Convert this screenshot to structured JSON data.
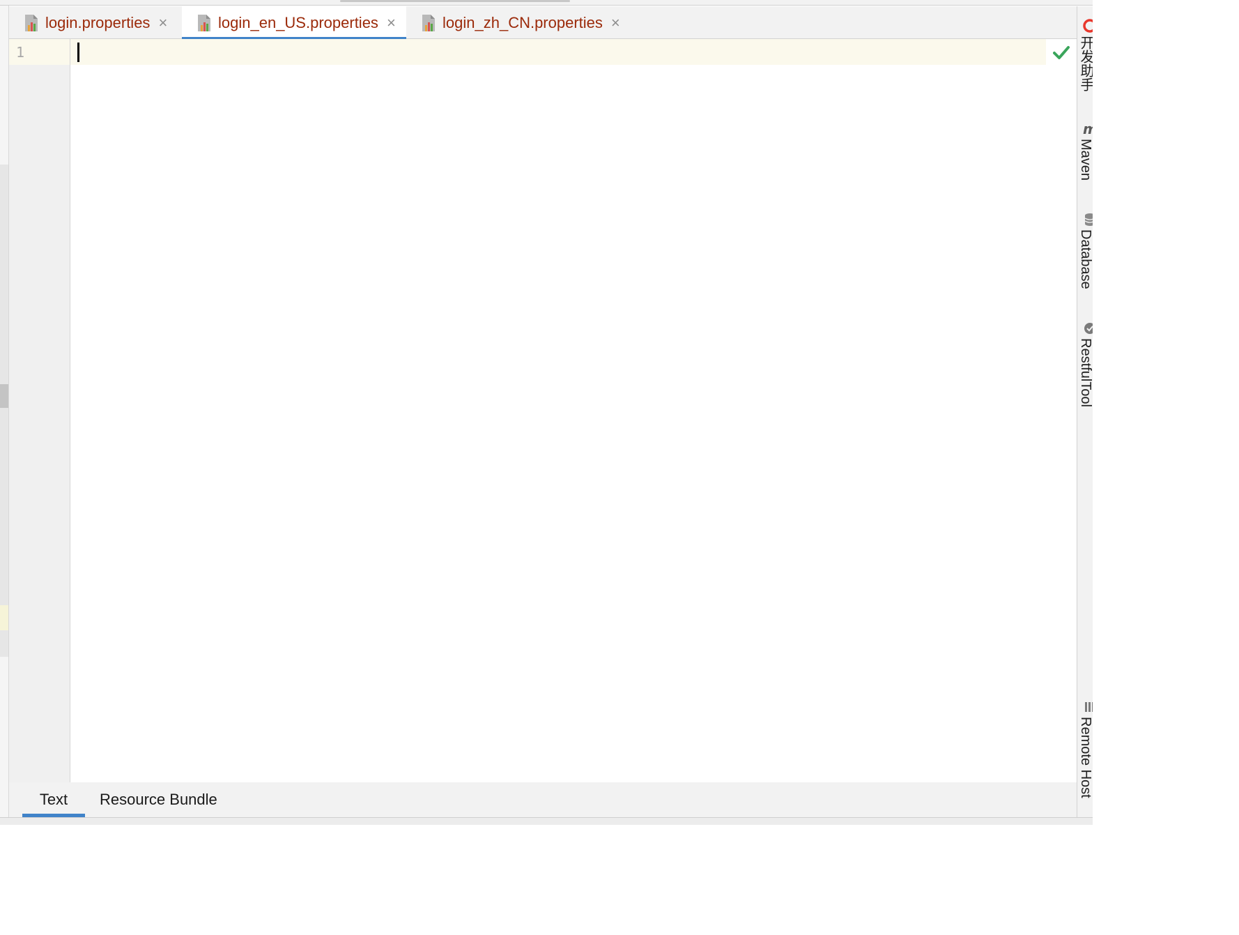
{
  "editor_tabs": [
    {
      "label": "login.properties",
      "close": "×",
      "active": false
    },
    {
      "label": "login_en_US.properties",
      "close": "×",
      "active": true
    },
    {
      "label": "login_zh_CN.properties",
      "close": "×",
      "active": false
    }
  ],
  "editor": {
    "line_numbers": [
      "1"
    ],
    "status_icon": "checkmark-icon",
    "status_color": "#3aa55b"
  },
  "bottom_tabs": [
    {
      "label": "Text",
      "active": true
    },
    {
      "label": "Resource Bundle",
      "active": false
    }
  ],
  "right_tools": [
    {
      "label": "开发助手",
      "icon": "dev-assistant-icon"
    },
    {
      "label": "Maven",
      "icon": "maven-icon"
    },
    {
      "label": "Database",
      "icon": "database-icon"
    },
    {
      "label": "RestfulTool",
      "icon": "restful-tool-icon"
    },
    {
      "label": "Remote Host",
      "icon": "remote-host-icon"
    }
  ],
  "colors": {
    "tab_text": "#9b2a0a",
    "accent": "#4083c9",
    "current_line": "#fbf9ec"
  }
}
